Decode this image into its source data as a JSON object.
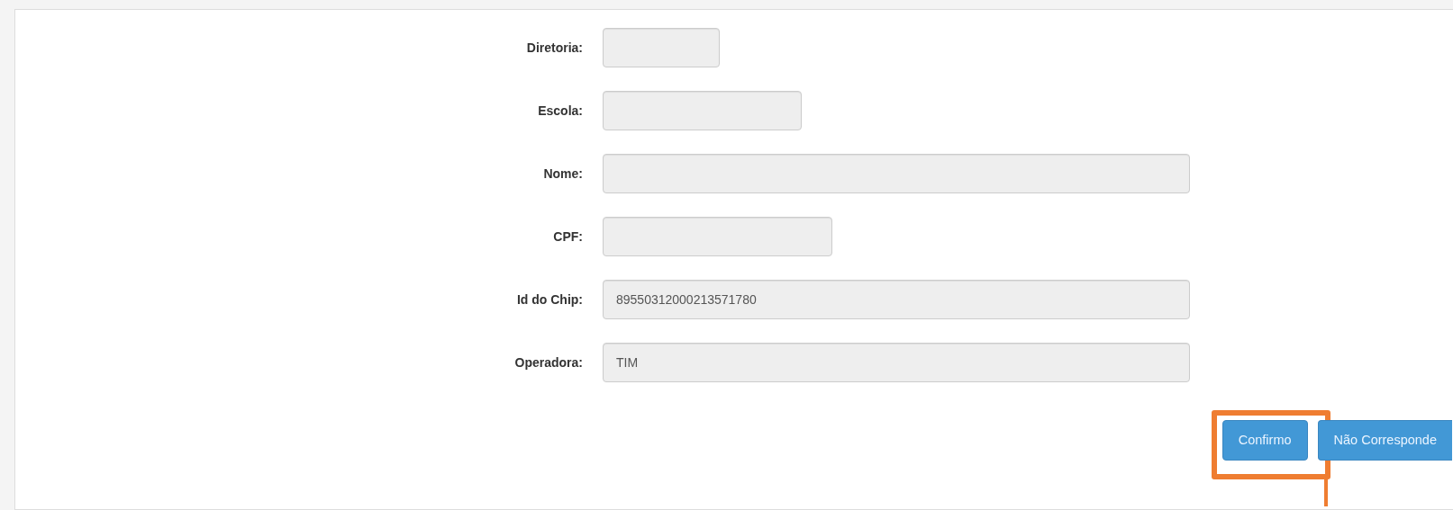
{
  "form": {
    "fields": [
      {
        "label": "Diretoria:",
        "disabled": true
      },
      {
        "label": "Escola:",
        "disabled": true
      },
      {
        "label": "Nome:",
        "disabled": true
      },
      {
        "label": "CPF:",
        "disabled": true
      },
      {
        "label": "Id do Chip:",
        "value": "89550312000213571780",
        "disabled": true
      },
      {
        "label": "Operadora:",
        "value": "TIM",
        "disabled": true
      }
    ]
  },
  "buttons": [
    {
      "label": "Confirmo",
      "highlighted": true
    },
    {
      "label": "Não Corresponde",
      "highlighted": false
    }
  ]
}
